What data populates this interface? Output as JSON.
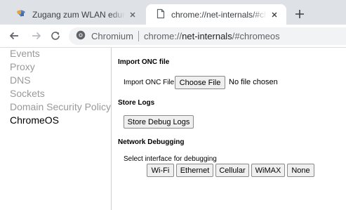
{
  "tabs": [
    {
      "title": "Zugang zum WLAN eduroam un",
      "icon": "wifi-icon",
      "active": false
    },
    {
      "title": "chrome://net-internals/#chromeos",
      "icon": "document-icon",
      "active": true
    }
  ],
  "new_tab_icon": "plus-icon",
  "toolbar": {
    "omnibox_label": "Chromium",
    "url_scheme": "chrome://",
    "url_host": "net-internals",
    "url_rest": "/#chromeos"
  },
  "sidebar": {
    "items": [
      {
        "label": "Events"
      },
      {
        "label": "Proxy"
      },
      {
        "label": "DNS"
      },
      {
        "label": "Sockets"
      },
      {
        "label": "Domain Security Policy"
      },
      {
        "label": "ChromeOS"
      }
    ],
    "active": "ChromeOS"
  },
  "main": {
    "import_onc": {
      "heading": "Import ONC file",
      "label": "Import ONC File",
      "button": "Choose File",
      "status": "No file chosen"
    },
    "store_logs": {
      "heading": "Store Logs",
      "button": "Store Debug Logs"
    },
    "network_debugging": {
      "heading": "Network Debugging",
      "prompt": "Select interface for debugging",
      "buttons": [
        "Wi-Fi",
        "Ethernet",
        "Cellular",
        "WiMAX",
        "None"
      ]
    }
  },
  "colors": {
    "tabstrip_bg": "#dee1e6",
    "sidebar_inactive": "#999999",
    "sidebar_active": "#000000"
  }
}
